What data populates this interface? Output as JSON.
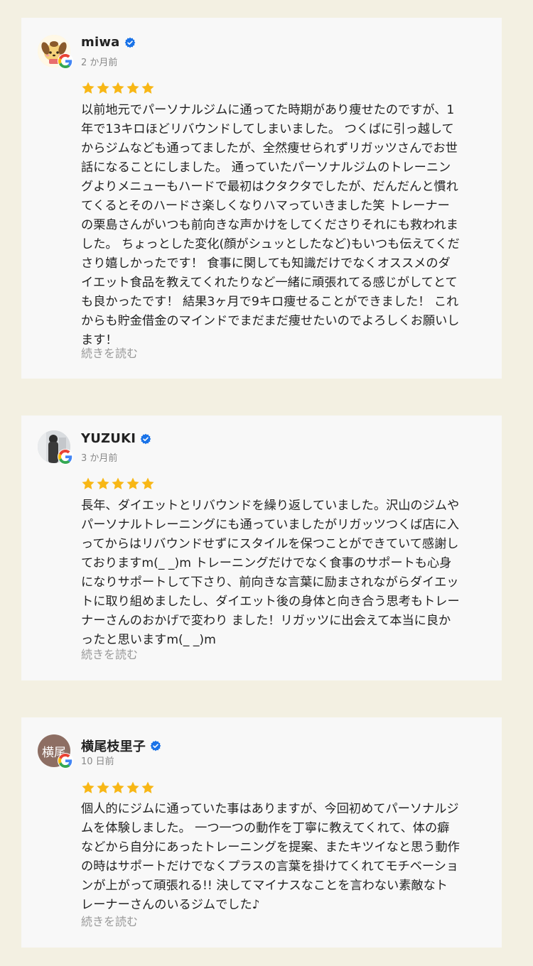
{
  "reviews": [
    {
      "name": "miwa",
      "date": "2 か月前",
      "rating": 5,
      "avatar": "character-illustration",
      "text": "以前地元でパーソナルジムに通ってた時期があり痩せたのですが、1\n年で13キロほどリバウンドしてしまいました。 つくばに引っ越して\nからジムなども通ってましたが、全然痩せられずリガッツさんでお世\n話になることにしました。 通っていたパーソナルジムのトレーニン\nグよりメニューもハードで最初はクタクタでしたが、だんだんと慣れ\nてくるとそのハードさ楽しくなりハマっていきました笑 トレーナー\nの栗島さんがいつも前向きな声かけをしてくださりそれにも救われま\nした。 ちょっとした変化(顔がシュッとしたなど)もいつも伝えてくだ\nさり嬉しかったです！ 食事に関しても知識だけでなくオススメのダ\nイエット食品を教えてくれたりなど一緒に頑張れてる感じがしてとて\nも良かったです！ 結果3ヶ月で9キロ痩せることができました！ これ\nからも貯金借金のマインドでまだまだ痩せたいのでよろしくお願いし\nます！",
      "read_more": "続きを読む"
    },
    {
      "name": "YUZUKI",
      "date": "3 か月前",
      "rating": 5,
      "avatar": "photo",
      "text": "長年、ダイエットとリバウンドを繰り返していました。沢山のジムや\nパーソナルトレーニングにも通っていましたがリガッツつくば店に入\nってからはリバウンドせずにスタイルを保つことができていて感謝し\nておりますm(_ _)m トレーニングだけでなく食事のサポートも心身\nになりサポートして下さり、前向きな言葉に励まされながらダイエッ\nトに取り組めましたし、ダイエット後の身体と向き合う思考もトレー\nナーさんのおかげで変わり ました！リガッツに出会えて本当に良か\nったと思いますm(_ _)m",
      "read_more": "続きを読む"
    },
    {
      "name": "横尾枝里子",
      "date": "10 日前",
      "rating": 5,
      "avatar_initial": "横尾",
      "avatar": "initials",
      "text": "個人的にジムに通っていた事はありますが、今回初めてパーソナルジ\nムを体験しました。 一つ一つの動作を丁寧に教えてくれて、体の癖\nなどから自分にあったトレーニングを提案、またキツイなと思う動作\nの時はサポートだけでなくプラスの言葉を掛けてくれてモチベーショ\nンが上がって頑張れる!! 決してマイナスなことを言わない素敵なト\nレーナーさんのいるジムでした♪",
      "read_more": "続きを読む"
    }
  ],
  "colors": {
    "background": "#f3f0e2",
    "card": "#f8f8f8",
    "star": "#f8b716",
    "verified": "#1a73e8",
    "muted": "#999999"
  },
  "icons": [
    "google-g-icon",
    "verified-badge-icon",
    "star-icon"
  ]
}
